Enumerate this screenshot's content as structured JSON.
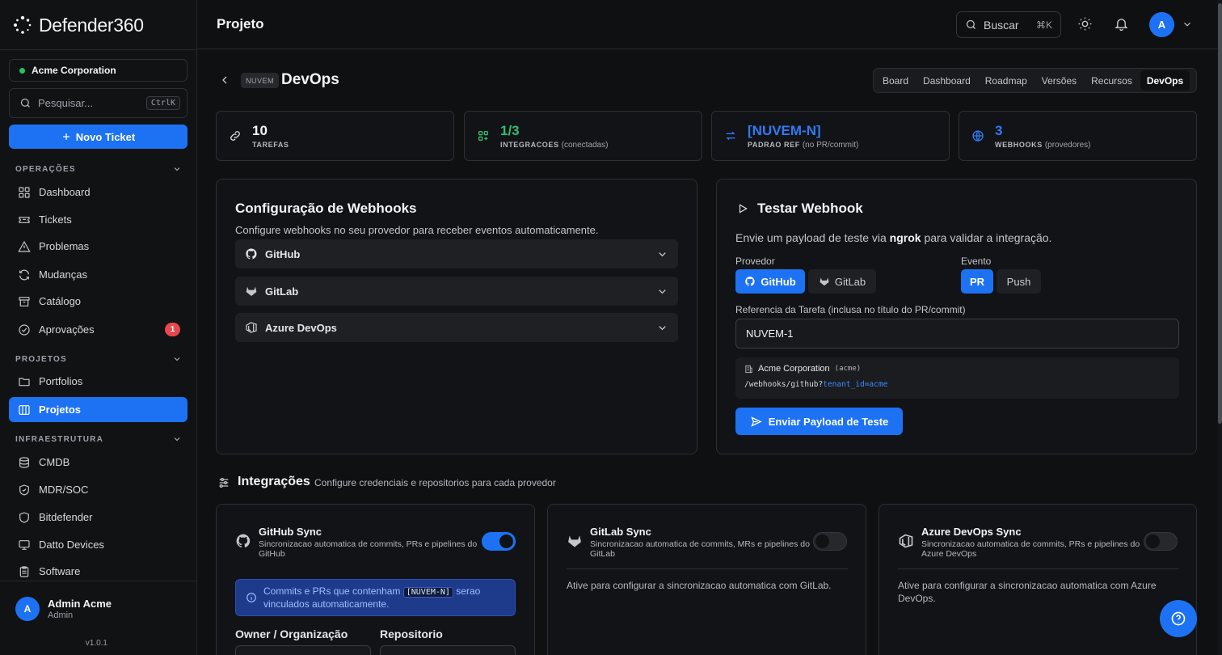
{
  "brand": {
    "name_light": "Defender",
    "name_bold": "360"
  },
  "sidebar": {
    "org_name": "Acme Corporation",
    "search_placeholder": "Pesquisar...",
    "search_shortcut": "CtrlK",
    "new_ticket_label": "Novo Ticket",
    "sections": [
      {
        "label": "OPERAÇÕES"
      },
      {
        "label": "PROJETOS"
      },
      {
        "label": "INFRAESTRUTURA"
      }
    ],
    "items": [
      {
        "label": "Dashboard",
        "icon": "grid-icon"
      },
      {
        "label": "Tickets",
        "icon": "ticket-icon"
      },
      {
        "label": "Problemas",
        "icon": "warning-icon"
      },
      {
        "label": "Mudanças",
        "icon": "refresh-icon"
      },
      {
        "label": "Catálogo",
        "icon": "archive-icon"
      },
      {
        "label": "Aprovações",
        "icon": "check-circle-icon",
        "badge": "1"
      },
      {
        "label": "Portfolios",
        "icon": "folder-icon"
      },
      {
        "label": "Projetos",
        "icon": "columns-icon",
        "active": true
      },
      {
        "label": "CMDB",
        "icon": "database-icon"
      },
      {
        "label": "MDR/SOC",
        "icon": "shield-icon"
      },
      {
        "label": "Bitdefender",
        "icon": "shield-icon"
      },
      {
        "label": "Datto Devices",
        "icon": "monitor-icon"
      },
      {
        "label": "Software",
        "icon": "clipboard-icon"
      }
    ],
    "user": {
      "initial": "A",
      "name": "Admin Acme",
      "role": "Admin"
    },
    "version": "v1.0.1"
  },
  "header": {
    "title": "Projeto",
    "search_label": "Buscar",
    "search_shortcut": "⌘K",
    "avatar_initial": "A"
  },
  "project": {
    "tag": "NUVEM",
    "name": "DevOps",
    "tabs": [
      {
        "label": "Board"
      },
      {
        "label": "Dashboard"
      },
      {
        "label": "Roadmap"
      },
      {
        "label": "Versões"
      },
      {
        "label": "Recursos"
      },
      {
        "label": "DevOps",
        "active": true
      }
    ]
  },
  "stats": [
    {
      "value": "10",
      "label": "TAREFAS",
      "note": "",
      "icon": "link-icon"
    },
    {
      "value": "1/3",
      "label": "INTEGRACOES",
      "note": "(conectadas)",
      "icon": "apps-icon"
    },
    {
      "value": "[NUVEM-N]",
      "label": "PADRAO REF",
      "note": "(no PR/commit)",
      "icon": "swap-icon"
    },
    {
      "value": "3",
      "label": "WEBHOOKS",
      "note": "(provedores)",
      "icon": "globe-icon"
    }
  ],
  "webhooks": {
    "title": "Configuração de Webhooks",
    "subtitle": "Configure webhooks no seu provedor para receber eventos automaticamente.",
    "providers": [
      {
        "label": "GitHub",
        "icon": "github-icon"
      },
      {
        "label": "GitLab",
        "icon": "gitlab-icon"
      },
      {
        "label": "Azure DevOps",
        "icon": "azure-devops-icon"
      }
    ]
  },
  "test": {
    "title": "Testar Webhook",
    "subtitle_pre": "Envie um payload de teste via ",
    "subtitle_bold": "ngrok",
    "subtitle_post": " para validar a integração.",
    "provider_label": "Provedor",
    "providers": [
      {
        "label": "GitHub",
        "active": true
      },
      {
        "label": "GitLab"
      }
    ],
    "event_label": "Evento",
    "events": [
      {
        "label": "PR",
        "active": true
      },
      {
        "label": "Push"
      }
    ],
    "ref_label": "Referencia da Tarefa (inclusa no título do PR/commit)",
    "ref_value": "NUVEM-1",
    "tenant_name": "Acme Corporation",
    "tenant_slug": "(acme)",
    "url_path": "/webhooks/github?",
    "url_query": "tenant_id=acme",
    "send_label": "Enviar Payload de Teste"
  },
  "integrations": {
    "title": "Integrações",
    "subtitle": "Configure credenciais e repositorios para cada provedor",
    "cards": [
      {
        "title": "GitHub Sync",
        "desc": "Sincronizacao automatica de commits, PRs e pipelines do GitHub",
        "enabled": true,
        "alert_pre": "Commits e PRs que contenham ",
        "alert_code": "[NUVEM-N]",
        "alert_post": " serao vinculados automaticamente.",
        "owner_label": "Owner / Organização",
        "repo_label": "Repositorio"
      },
      {
        "title": "GitLab Sync",
        "desc": "Sincronizacao automatica de commits, MRs e pipelines do GitLab",
        "enabled": false,
        "note": "Ative para configurar a sincronizacao automatica com GitLab."
      },
      {
        "title": "Azure DevOps Sync",
        "desc": "Sincronizacao automatica de commits, PRs e pipelines do Azure DevOps",
        "enabled": false,
        "note": "Ative para configurar a sincronizacao automatica com Azure DevOps."
      }
    ]
  },
  "colors": {
    "accent": "#1d72f3",
    "success": "#2fbf71",
    "danger": "#e5484d",
    "background": "#0f1012"
  }
}
